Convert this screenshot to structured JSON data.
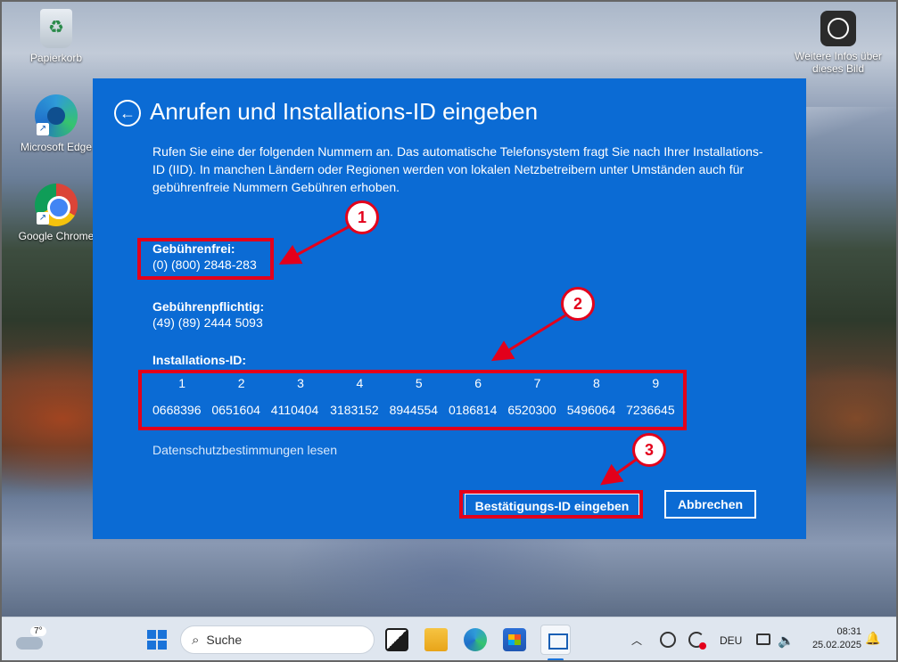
{
  "desktop": {
    "icons": [
      {
        "label": "Papierkorb",
        "icon": "recycle-bin-icon"
      },
      {
        "label": "Microsoft Edge",
        "icon": "edge-icon"
      },
      {
        "label": "Google Chrome",
        "icon": "chrome-icon"
      },
      {
        "label": "Weitere Infos über dieses Bild",
        "icon": "camera-icon"
      }
    ]
  },
  "dialog": {
    "title": "Anrufen und Installations-ID eingeben",
    "description": "Rufen Sie eine der folgenden Nummern an. Das automatische Telefonsystem fragt Sie nach Ihrer Installations-ID (IID). In manchen Ländern oder Regionen werden von lokalen Netzbetreibern unter Umständen auch für gebührenfreie Nummern Gebühren erhoben.",
    "toll_free_label": "Gebührenfrei:",
    "toll_free_number": "(0) (800) 2848-283",
    "toll_label": "Gebührenpflichtig:",
    "toll_number": "(49) (89) 2444 5093",
    "iid_label": "Installations-ID:",
    "iid_block_numbers": [
      "1",
      "2",
      "3",
      "4",
      "5",
      "6",
      "7",
      "8",
      "9"
    ],
    "iid_blocks": [
      "0668396",
      "0651604",
      "4110404",
      "3183152",
      "8944554",
      "0186814",
      "6520300",
      "5496064",
      "7236645"
    ],
    "privacy_link": "Datenschutzbestimmungen lesen",
    "confirm_button": "Bestätigungs-ID eingeben",
    "cancel_button": "Abbrechen"
  },
  "annotations": {
    "badges": [
      "1",
      "2",
      "3"
    ],
    "color": "#e3001b"
  },
  "taskbar": {
    "weather_temp": "7°",
    "search_placeholder": "Suche",
    "language": "DEU",
    "time": "08:31",
    "date": "25.02.2025"
  },
  "colors": {
    "dialog_bg": "#0b6bd4",
    "taskbar_bg": "#dfe6ef"
  }
}
